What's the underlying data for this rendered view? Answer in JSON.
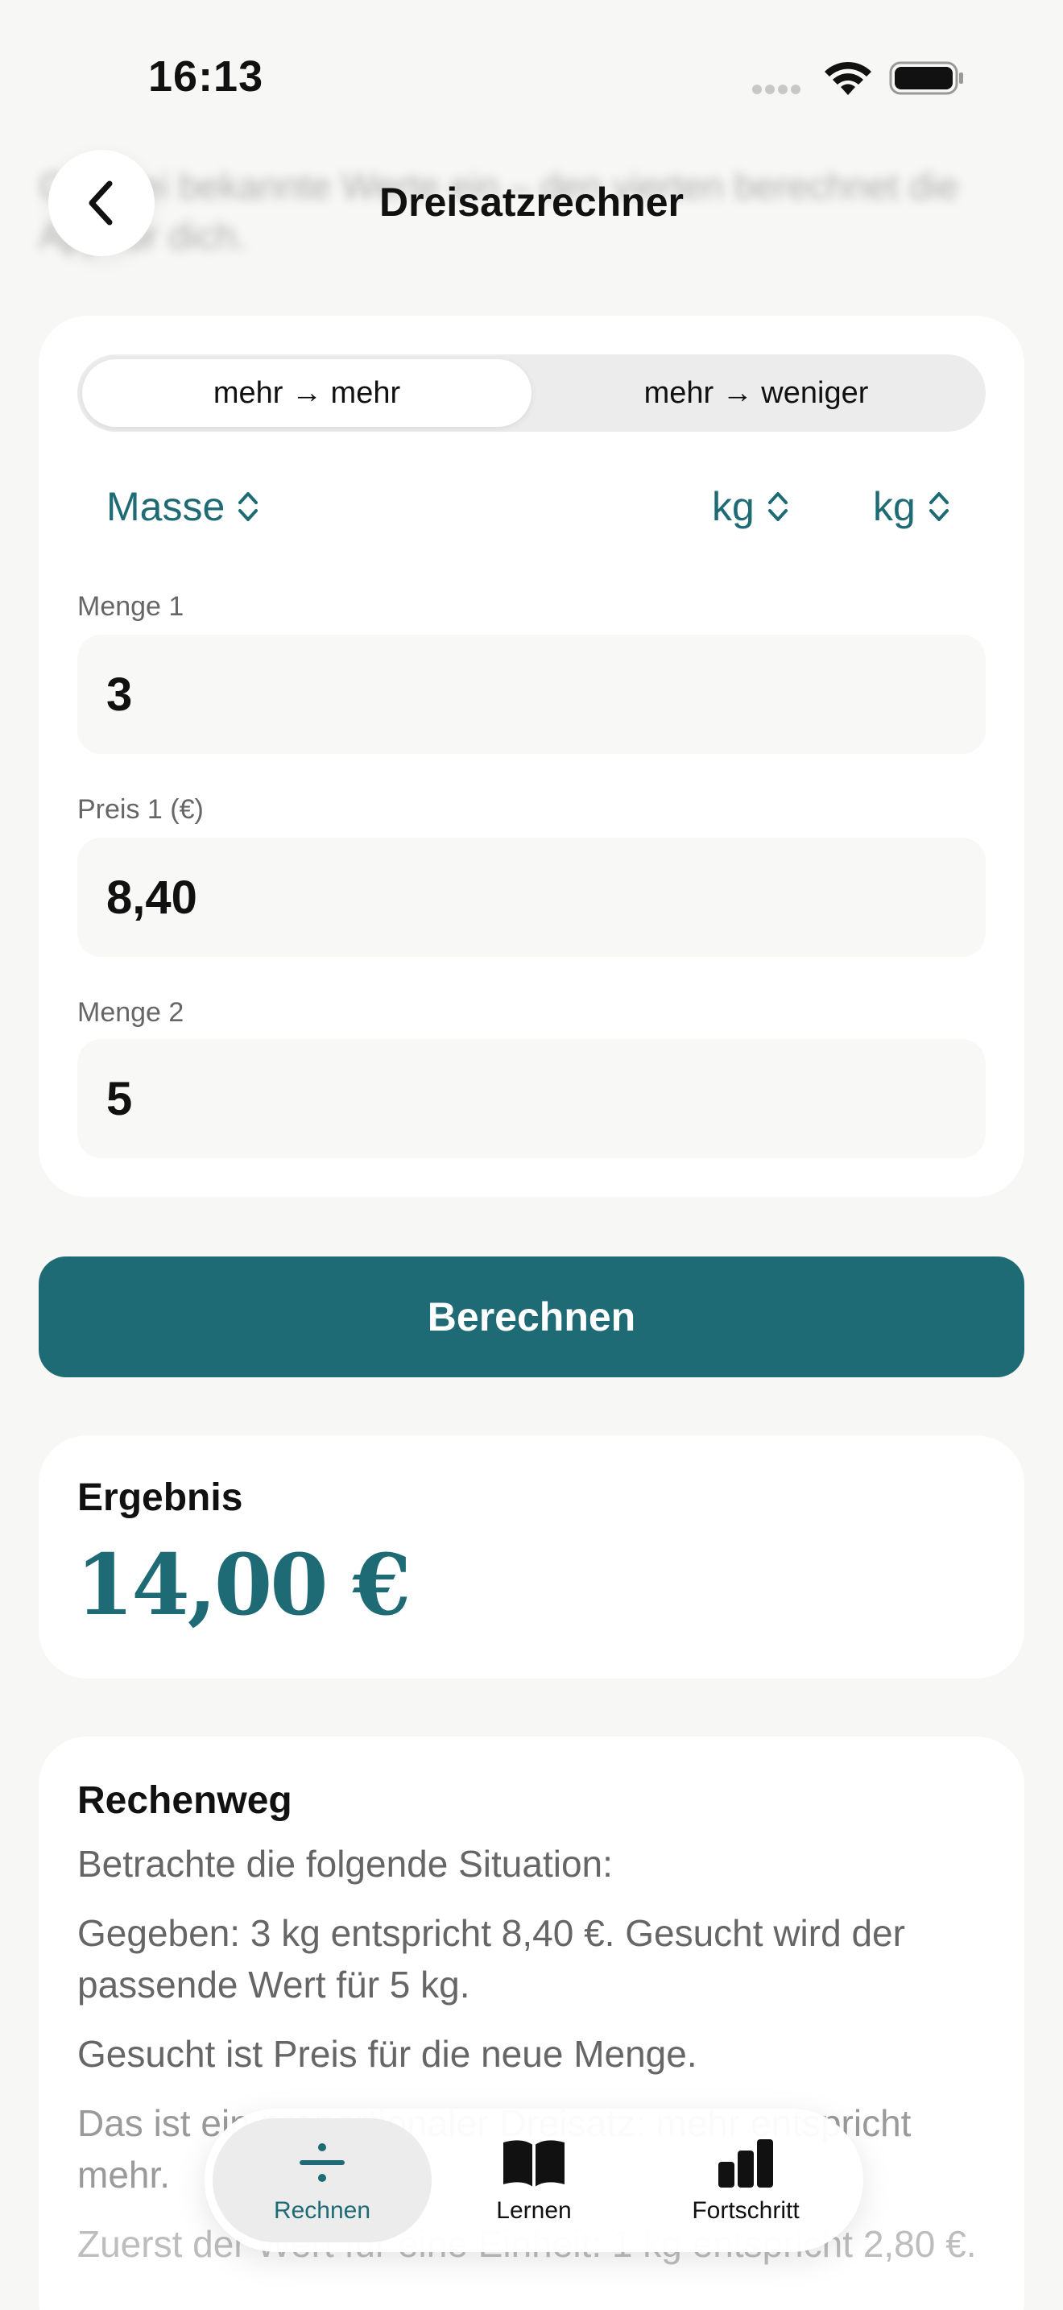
{
  "status_bar": {
    "time": "16:13"
  },
  "header": {
    "title": "Dreisatzrechner",
    "intro_text": "Gib drei bekannte Werte ein – den vierten berechnet die App für dich."
  },
  "mode_toggle": {
    "options": [
      "mehr → mehr",
      "mehr → weniger"
    ],
    "selected": "mehr → mehr"
  },
  "pickers": {
    "quantity_type": "Masse",
    "unit_1": "kg",
    "unit_2": "kg"
  },
  "fields": [
    {
      "label": "Menge 1",
      "value": "3"
    },
    {
      "label": "Preis 1 (€)",
      "value": "8,40"
    },
    {
      "label": "Menge 2",
      "value": "5"
    }
  ],
  "calculate_button": "Berechnen",
  "result": {
    "heading": "Ergebnis",
    "value": "14,00 €"
  },
  "steps": {
    "heading": "Rechenweg",
    "items": [
      "Betrachte die folgende Situation:",
      "Gegeben: 3 kg entspricht 8,40 €. Gesucht wird der passende Wert für 5 kg.",
      "Gesucht ist Preis für die neue Menge.",
      "Das ist ein proportionaler Dreisatz: mehr entspricht mehr.",
      "Zuerst der Wert für eine Einheit: 1 kg entspricht 2,80 €."
    ]
  },
  "tab_bar": {
    "tabs": [
      {
        "label": "Rechnen",
        "icon": "divide-icon",
        "active": true
      },
      {
        "label": "Lernen",
        "icon": "book-icon",
        "active": false
      },
      {
        "label": "Fortschritt",
        "icon": "bar-chart-icon",
        "active": false
      }
    ]
  },
  "colors": {
    "accent": "#1e6b76",
    "background": "#f7f7f5",
    "card": "#ffffff",
    "field": "#f8f8f6"
  }
}
